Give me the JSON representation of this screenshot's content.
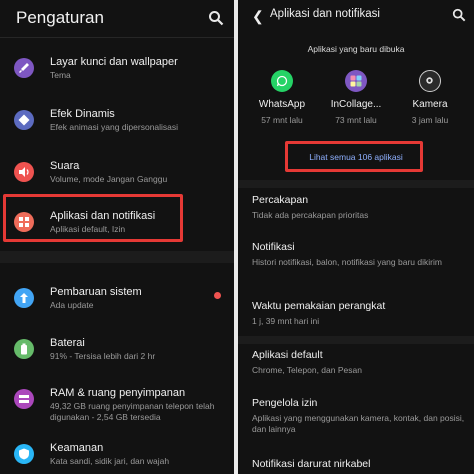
{
  "left": {
    "title": "Pengaturan",
    "items": [
      {
        "title": "Layar kunci dan wallpaper",
        "sub": "Tema",
        "color": "#7e57c2",
        "icon": "brush-icon"
      },
      {
        "title": "Efek Dinamis",
        "sub": "Efek animasi yang dipersonalisasi",
        "color": "#5c6bc0",
        "icon": "diamond-icon"
      },
      {
        "title": "Suara",
        "sub": "Volume, mode Jangan Ganggu",
        "color": "#ef5350",
        "icon": "speaker-icon"
      },
      {
        "title": "Aplikasi dan notifikasi",
        "sub": "Aplikasi default, Izin",
        "color": "#ef6c5a",
        "icon": "apps-icon"
      },
      {
        "title": "Pembaruan sistem",
        "sub": "Ada update",
        "color": "#42a5f5",
        "icon": "update-icon"
      },
      {
        "title": "Baterai",
        "sub": "91% - Tersisa lebih dari 2 hr",
        "color": "#66bb6a",
        "icon": "battery-icon"
      },
      {
        "title": "RAM & ruang penyimpanan",
        "sub": "49,32 GB ruang penyimpanan telepon telah digunakan - 2,54 GB tersedia",
        "color": "#ab47bc",
        "icon": "storage-icon"
      },
      {
        "title": "Keamanan",
        "sub": "Kata sandi, sidik jari, dan wajah",
        "color": "#29b6f6",
        "icon": "shield-icon"
      }
    ]
  },
  "right": {
    "title": "Aplikasi dan notifikasi",
    "recent_title": "Aplikasi yang baru dibuka",
    "apps": [
      {
        "name": "WhatsApp",
        "time": "57 mnt lalu",
        "color": "#25d366",
        "icon": "whatsapp-icon"
      },
      {
        "name": "InCollage...",
        "time": "73 mnt lalu",
        "color": "#7e57c2",
        "icon": "incollage-icon"
      },
      {
        "name": "Kamera",
        "time": "3 jam lalu",
        "color": "#2a2a2a",
        "icon": "camera-icon"
      }
    ],
    "see_all": "Lihat semua 106 aplikasi",
    "items": [
      {
        "title": "Percakapan",
        "sub": "Tidak ada percakapan prioritas"
      },
      {
        "title": "Notifikasi",
        "sub": "Histori notifikasi, balon, notifikasi yang baru dikirim"
      },
      {
        "title": "Waktu pemakaian perangkat",
        "sub": "1 j, 39 mnt hari ini"
      },
      {
        "title": "Aplikasi default",
        "sub": "Chrome, Telepon, dan Pesan"
      },
      {
        "title": "Pengelola izin",
        "sub": "Aplikasi yang menggunakan kamera, kontak, dan posisi, dan lainnya"
      },
      {
        "title": "Notifikasi darurat nirkabel",
        "sub": ""
      }
    ]
  },
  "colors": {
    "highlight": "#e53935",
    "link": "#8fb0ff",
    "background": "#121212"
  }
}
